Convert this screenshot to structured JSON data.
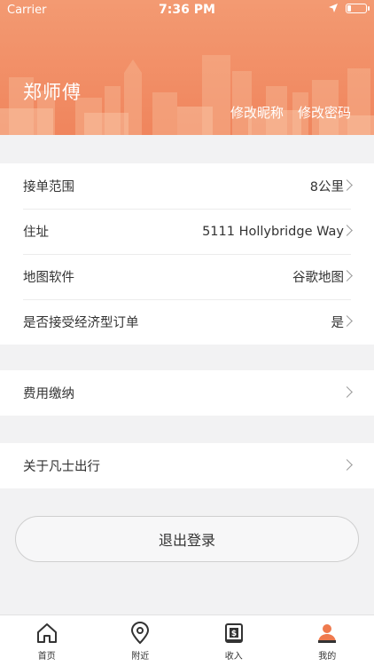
{
  "status_bar": {
    "carrier": "Carrier",
    "time": "7:36 PM"
  },
  "profile": {
    "name": "郑师傅",
    "edit_nickname": "修改昵称",
    "edit_password": "修改密码"
  },
  "settings": [
    {
      "label": "接单范围",
      "value": "8公里"
    },
    {
      "label": "住址",
      "value": "5111 Hollybridge Way"
    },
    {
      "label": "地图软件",
      "value": "谷歌地图"
    },
    {
      "label": "是否接受经济型订单",
      "value": "是"
    }
  ],
  "fees": {
    "label": "费用缴纳"
  },
  "about": {
    "label": "关于凡士出行"
  },
  "logout_label": "退出登录",
  "tabs": [
    {
      "label": "首页",
      "icon": "home-icon"
    },
    {
      "label": "附近",
      "icon": "location-pin-icon"
    },
    {
      "label": "收入",
      "icon": "wallet-icon"
    },
    {
      "label": "我的",
      "icon": "user-icon",
      "active": true
    }
  ],
  "colors": {
    "header": "#f0855d",
    "accent": "#ef7a4e",
    "background": "#f2f2f3"
  },
  "battery_level": 0.2
}
